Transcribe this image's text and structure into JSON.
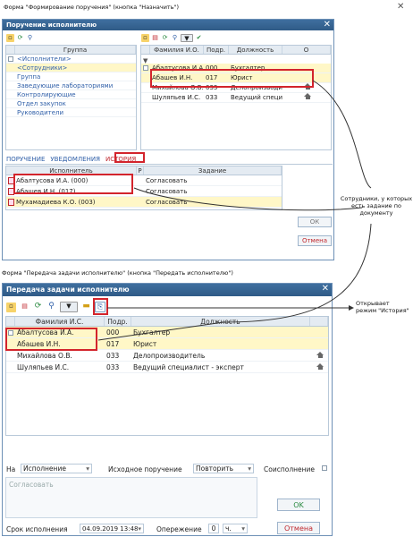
{
  "caption1": "Форма \"Формирование поручения\" (кнопка \"Назначить\")",
  "caption2": "Форма \"Передача задачи исполнителю\" (кнопка \"Передать исполнителю\")",
  "annot_staff": "Сотрудники, у которых есть задание по документу",
  "annot_history": "Открывает режим \"История\"",
  "window1": {
    "title": "Поручение исполнителю",
    "group_header": "Группа",
    "groups": [
      "<Исполнители>",
      "<Сотрудники>",
      "Группа",
      "Заведующие лабораториями",
      "Контролирующие",
      "Отдел закупок",
      "Руководители"
    ],
    "staff_headers": [
      "Фамилия И.О.",
      "Подр.",
      "Должность",
      "О"
    ],
    "staff": [
      {
        "name": "Абалтусова И.А.",
        "dept": "000",
        "pos": "Бухгалтер",
        "o": ""
      },
      {
        "name": "Абашев И.Н.",
        "dept": "017",
        "pos": "Юрист",
        "o": ""
      },
      {
        "name": "Михайлова О.В.",
        "dept": "033",
        "pos": "Делопроизводит",
        "o": "house"
      },
      {
        "name": "Шуляпьев И.С.",
        "dept": "033",
        "pos": "Ведущий специ",
        "o": "house"
      }
    ],
    "tabs": [
      "ПОРУЧЕНИЕ",
      "УВЕДОМЛЕНИЯ",
      "ИСТОРИЯ"
    ],
    "hist_headers": [
      "Исполнитель",
      "Р",
      "Задание"
    ],
    "history": [
      {
        "exec": "Абалтусова И.А. (000)",
        "task": "Согласовать"
      },
      {
        "exec": "Абашев И.Н. (017)",
        "task": "Согласовать"
      },
      {
        "exec": "Мухамадиева К.О. (003)",
        "task": "Согласовать"
      }
    ],
    "ok": "ОК",
    "cancel": "Отмена"
  },
  "window2": {
    "title": "Передача задачи исполнителю",
    "headers": [
      "Фамилия И.С.",
      "Подр.",
      "Должность"
    ],
    "rows": [
      {
        "name": "Абалтусова И.А.",
        "dept": "000",
        "pos": "Бухгалтер",
        "home": false
      },
      {
        "name": "Абашев И.Н.",
        "dept": "017",
        "pos": "Юрист",
        "home": false
      },
      {
        "name": "Михайлова О.В.",
        "dept": "033",
        "pos": "Делопроизводитель",
        "home": true
      },
      {
        "name": "Шуляпьев И.С.",
        "dept": "033",
        "pos": "Ведущий  специалист - эксперт",
        "home": true
      }
    ],
    "on_label": "На",
    "on_value": "Исполнение",
    "src_label": "Исходное поручение",
    "src_value": "Повторить",
    "coexec_label": "Соисполнение",
    "task_placeholder": "Согласовать",
    "ok": "OK",
    "deadline_label": "Срок исполнения",
    "deadline_value": "04.09.2019 13:48",
    "advance_label": "Опережение",
    "advance_value": "0",
    "advance_unit": "ч.",
    "cancel": "Отмена"
  },
  "colors": {
    "title": "#2f5b87",
    "highlight_row": "#fff7c7",
    "red_box": "#d3242c",
    "link": "#2f5fa8"
  }
}
